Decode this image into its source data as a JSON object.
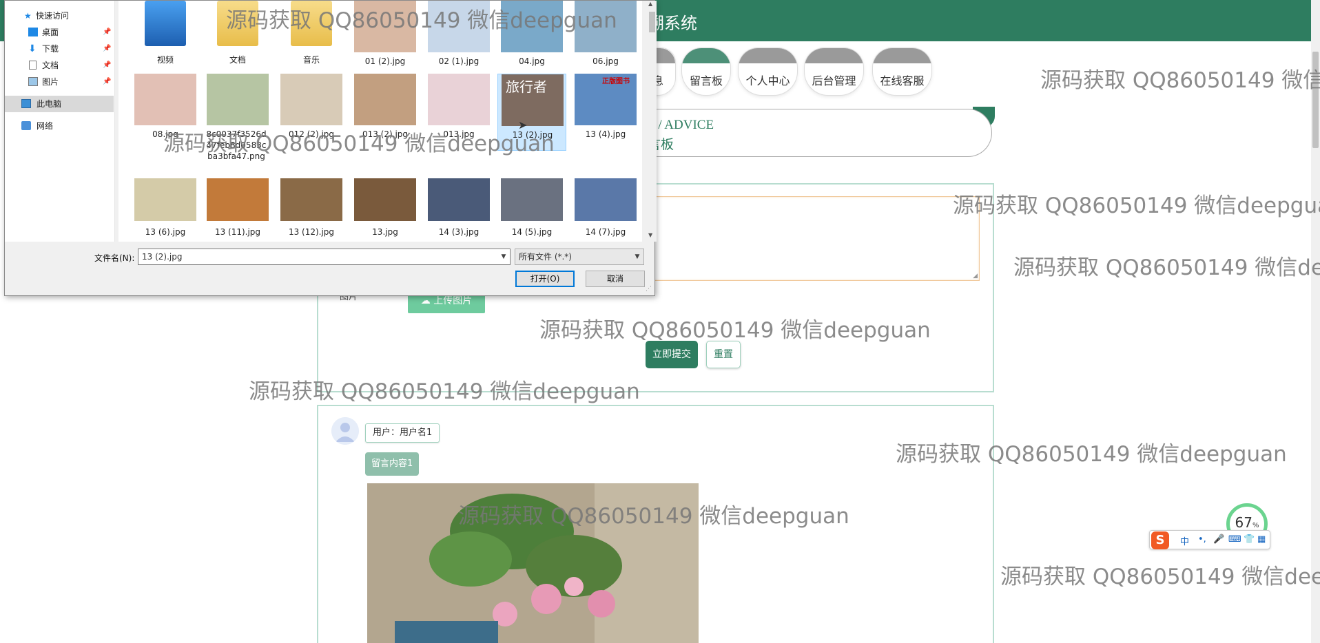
{
  "app": {
    "title": "溯系统"
  },
  "nav": {
    "items": [
      {
        "label": "息",
        "active": false
      },
      {
        "label": "留言板",
        "active": true
      },
      {
        "label": "个人中心",
        "active": false
      },
      {
        "label": "后台管理",
        "active": false
      },
      {
        "label": "在线客服",
        "active": false
      }
    ]
  },
  "breadcrumb": {
    "en": "S / ADVICE",
    "cn": "言板"
  },
  "form": {
    "image_label": "图片",
    "upload_label": "上传图片",
    "submit_label": "立即提交",
    "reset_label": "重置"
  },
  "message": {
    "user_label": "用户：用户名1",
    "content": "留言内容1"
  },
  "watermark": "源码获取 QQ86050149 微信deepguan",
  "dialog": {
    "nav": [
      {
        "label": "快速访问",
        "icon": "star-icon",
        "pinned": false
      },
      {
        "label": "桌面",
        "icon": "desktop-icon",
        "pinned": true
      },
      {
        "label": "下载",
        "icon": "download-icon",
        "pinned": true
      },
      {
        "label": "文档",
        "icon": "document-icon",
        "pinned": true
      },
      {
        "label": "图片",
        "icon": "picture-icon",
        "pinned": true
      },
      {
        "label": "此电脑",
        "icon": "computer-icon",
        "pinned": false
      },
      {
        "label": "网络",
        "icon": "network-icon",
        "pinned": false
      }
    ],
    "files": [
      {
        "name": "视频",
        "kind": "folder"
      },
      {
        "name": "文档",
        "kind": "folder"
      },
      {
        "name": "音乐",
        "kind": "folder"
      },
      {
        "name": "01 (2).jpg",
        "kind": "image"
      },
      {
        "name": "02 (1).jpg",
        "kind": "image"
      },
      {
        "name": "04.jpg",
        "kind": "image"
      },
      {
        "name": "06.jpg",
        "kind": "image"
      },
      {
        "name": "08.jpg",
        "kind": "image"
      },
      {
        "name": "8c0037f3526d47feb8d0583cba3bfa47.png",
        "kind": "image"
      },
      {
        "name": "012 (2).jpg",
        "kind": "image"
      },
      {
        "name": "013 (2).jpg",
        "kind": "image"
      },
      {
        "name": "013.jpg",
        "kind": "image"
      },
      {
        "name": "13 (2).jpg",
        "kind": "image",
        "selected": true
      },
      {
        "name": "13 (4).jpg",
        "kind": "image"
      },
      {
        "name": "13 (6).jpg",
        "kind": "image"
      },
      {
        "name": "13 (11).jpg",
        "kind": "image"
      },
      {
        "name": "13 (12).jpg",
        "kind": "image"
      },
      {
        "name": "13.jpg",
        "kind": "image"
      },
      {
        "name": "14 (3).jpg",
        "kind": "image"
      },
      {
        "name": "14 (5).jpg",
        "kind": "image"
      },
      {
        "name": "14 (7).jpg",
        "kind": "image"
      }
    ],
    "filename_label": "文件名(N):",
    "filename_value": "13 (2).jpg",
    "filetype_value": "所有文件 (*.*)",
    "open_label": "打开(O)",
    "cancel_label": "取消",
    "thumb_text_travel": "旅行者",
    "thumb_text_book": "正版图书"
  },
  "tray": {
    "percent": "67",
    "percent_sign": "%",
    "ime": "中"
  },
  "colors": {
    "primary": "#2e7d60",
    "accent": "#6ecb9e",
    "tag": "#8fbfab"
  }
}
